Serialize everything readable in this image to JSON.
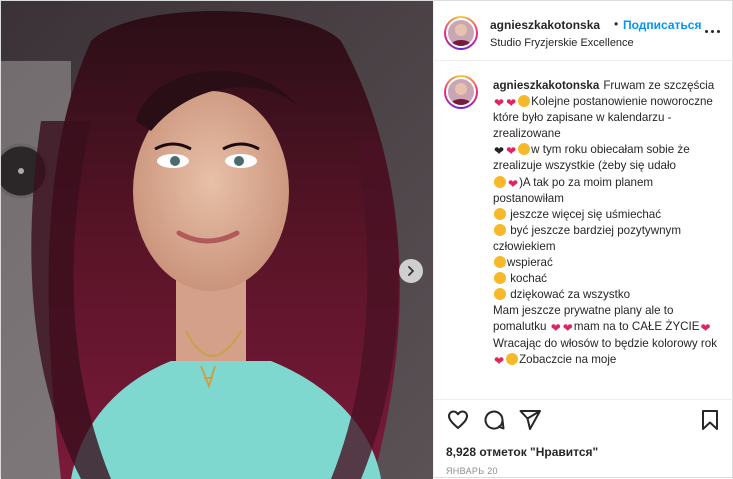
{
  "header": {
    "username": "agnieszkakotonska",
    "dot": "•",
    "follow_label": "Подписаться",
    "location": "Studio Fryzjerskie Excellence",
    "more_icon": "more-horizontal-icon"
  },
  "caption": {
    "username": "agnieszkakotonska",
    "lines": [
      "Fruwam ze szczęścia",
      "Kolejne postanowienie noworoczne które było zapisane w kalendarzu - zrealizowane",
      "w tym roku obiecałam sobie że zrealizuje wszystkie (żeby się udało",
      ")A tak po za moim planem postanowiłam",
      "jeszcze więcej się uśmiechać",
      "być jeszcze bardziej pozytywnym człowiekiem",
      "wspierać",
      "kochać",
      "dziękować za wszystko",
      "Mam jeszcze prywatne plany ale to pomalutku",
      "mam na to CAŁE ŻYCIE",
      "Wracając do włosów to będzie kolorowy rok",
      "Zobaczcie na moje"
    ]
  },
  "actions": {
    "like_icon": "heart-icon",
    "comment_icon": "comment-icon",
    "share_icon": "send-icon",
    "save_icon": "bookmark-icon"
  },
  "likes_text": "8,928 отметок \"Нравится\"",
  "date_text": "ЯНВАРЬ 20",
  "colors": {
    "link": "#0095f6",
    "heart": "#e0245e",
    "text": "#262626",
    "muted": "#8e8e8e"
  }
}
